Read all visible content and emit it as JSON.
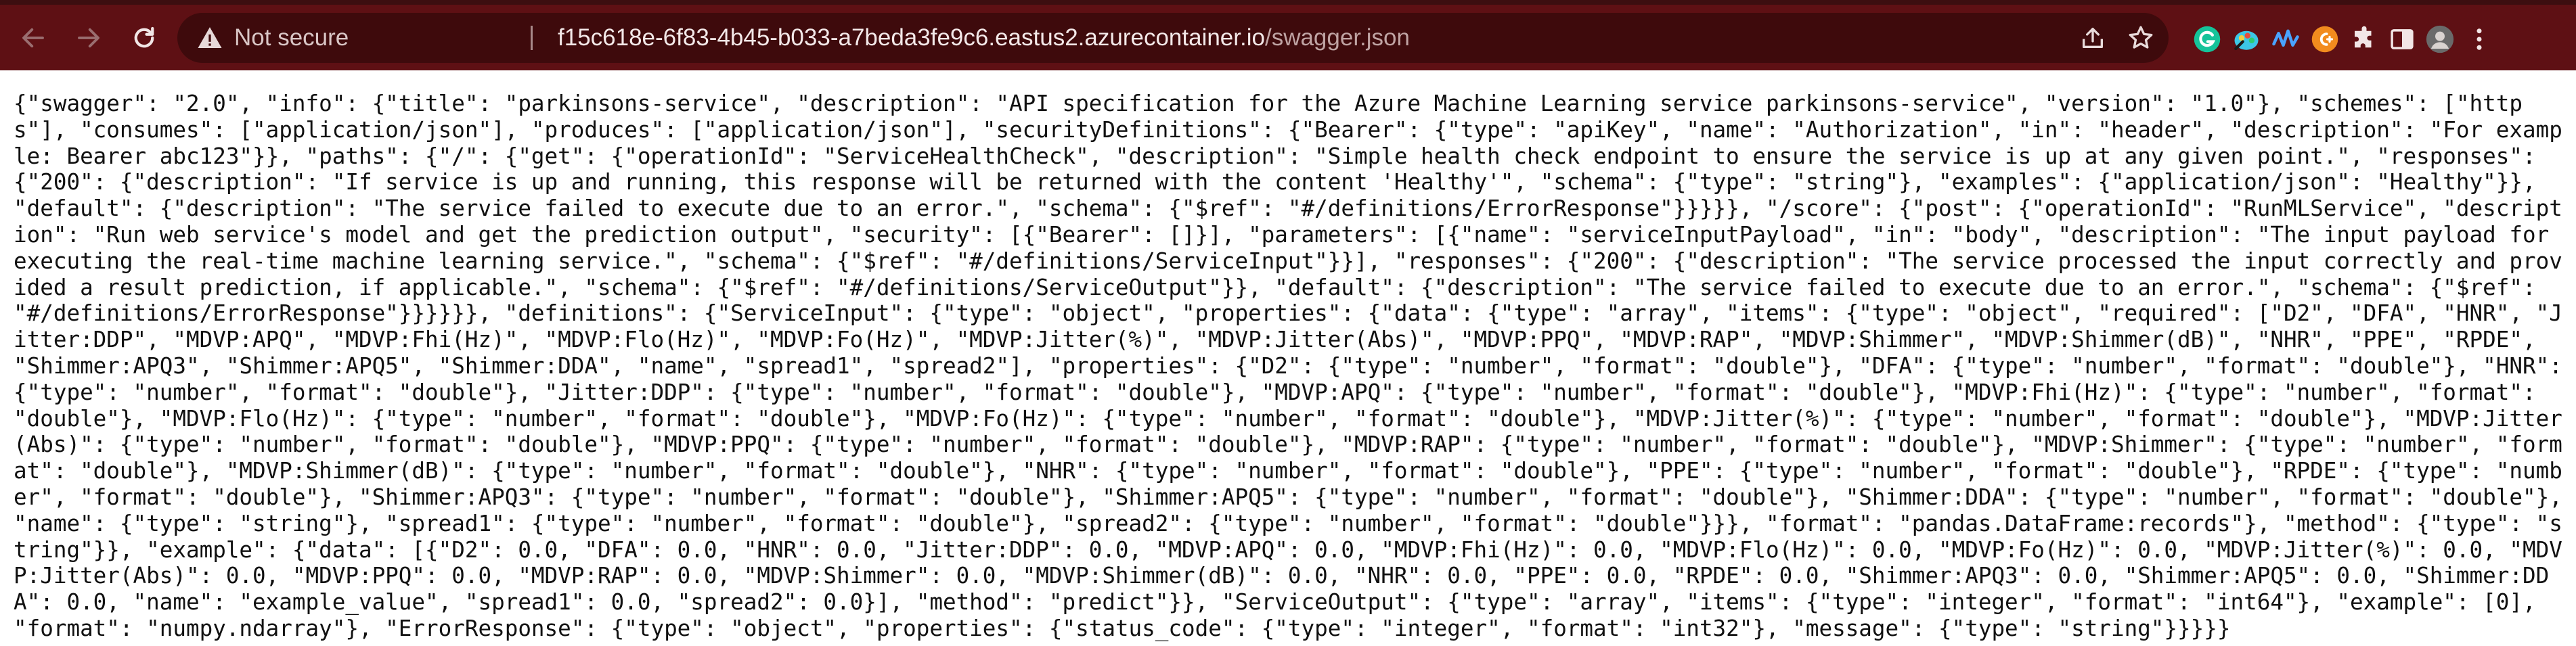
{
  "browser": {
    "security_status": "Not secure",
    "url_host": "f15c618e-6f83-4b45-b033-a7beda3fe9c6.eastus2.azurecontainer.io",
    "url_path": "/swagger.json",
    "toolbar_color": "#5e1014",
    "extensions": [
      "grammarly-icon",
      "color-picker-extension-icon",
      "waveform-extension-icon",
      "coupon-extension-icon",
      "puzzle-extensions-icon",
      "side-panel-icon",
      "profile-avatar"
    ]
  },
  "document": {
    "body_text": "{\"swagger\": \"2.0\", \"info\": {\"title\": \"parkinsons-service\", \"description\": \"API specification for the Azure Machine Learning service parkinsons-service\", \"version\": \"1.0\"}, \"schemes\": [\"https\"], \"consumes\": [\"application/json\"], \"produces\": [\"application/json\"], \"securityDefinitions\": {\"Bearer\": {\"type\": \"apiKey\", \"name\": \"Authorization\", \"in\": \"header\", \"description\": \"For example: Bearer abc123\"}}, \"paths\": {\"/\": {\"get\": {\"operationId\": \"ServiceHealthCheck\", \"description\": \"Simple health check endpoint to ensure the service is up at any given point.\", \"responses\": {\"200\": {\"description\": \"If service is up and running, this response will be returned with the content 'Healthy'\", \"schema\": {\"type\": \"string\"}, \"examples\": {\"application/json\": \"Healthy\"}}, \"default\": {\"description\": \"The service failed to execute due to an error.\", \"schema\": {\"$ref\": \"#/definitions/ErrorResponse\"}}}}}, \"/score\": {\"post\": {\"operationId\": \"RunMLService\", \"description\": \"Run web service's model and get the prediction output\", \"security\": [{\"Bearer\": []}], \"parameters\": [{\"name\": \"serviceInputPayload\", \"in\": \"body\", \"description\": \"The input payload for executing the real-time machine learning service.\", \"schema\": {\"$ref\": \"#/definitions/ServiceInput\"}}], \"responses\": {\"200\": {\"description\": \"The service processed the input correctly and provided a result prediction, if applicable.\", \"schema\": {\"$ref\": \"#/definitions/ServiceOutput\"}}, \"default\": {\"description\": \"The service failed to execute due to an error.\", \"schema\": {\"$ref\": \"#/definitions/ErrorResponse\"}}}}}}, \"definitions\": {\"ServiceInput\": {\"type\": \"object\", \"properties\": {\"data\": {\"type\": \"array\", \"items\": {\"type\": \"object\", \"required\": [\"D2\", \"DFA\", \"HNR\", \"Jitter:DDP\", \"MDVP:APQ\", \"MDVP:Fhi(Hz)\", \"MDVP:Flo(Hz)\", \"MDVP:Fo(Hz)\", \"MDVP:Jitter(%)\", \"MDVP:Jitter(Abs)\", \"MDVP:PPQ\", \"MDVP:RAP\", \"MDVP:Shimmer\", \"MDVP:Shimmer(dB)\", \"NHR\", \"PPE\", \"RPDE\", \"Shimmer:APQ3\", \"Shimmer:APQ5\", \"Shimmer:DDA\", \"name\", \"spread1\", \"spread2\"], \"properties\": {\"D2\": {\"type\": \"number\", \"format\": \"double\"}, \"DFA\": {\"type\": \"number\", \"format\": \"double\"}, \"HNR\": {\"type\": \"number\", \"format\": \"double\"}, \"Jitter:DDP\": {\"type\": \"number\", \"format\": \"double\"}, \"MDVP:APQ\": {\"type\": \"number\", \"format\": \"double\"}, \"MDVP:Fhi(Hz)\": {\"type\": \"number\", \"format\": \"double\"}, \"MDVP:Flo(Hz)\": {\"type\": \"number\", \"format\": \"double\"}, \"MDVP:Fo(Hz)\": {\"type\": \"number\", \"format\": \"double\"}, \"MDVP:Jitter(%)\": {\"type\": \"number\", \"format\": \"double\"}, \"MDVP:Jitter(Abs)\": {\"type\": \"number\", \"format\": \"double\"}, \"MDVP:PPQ\": {\"type\": \"number\", \"format\": \"double\"}, \"MDVP:RAP\": {\"type\": \"number\", \"format\": \"double\"}, \"MDVP:Shimmer\": {\"type\": \"number\", \"format\": \"double\"}, \"MDVP:Shimmer(dB)\": {\"type\": \"number\", \"format\": \"double\"}, \"NHR\": {\"type\": \"number\", \"format\": \"double\"}, \"PPE\": {\"type\": \"number\", \"format\": \"double\"}, \"RPDE\": {\"type\": \"number\", \"format\": \"double\"}, \"Shimmer:APQ3\": {\"type\": \"number\", \"format\": \"double\"}, \"Shimmer:APQ5\": {\"type\": \"number\", \"format\": \"double\"}, \"Shimmer:DDA\": {\"type\": \"number\", \"format\": \"double\"}, \"name\": {\"type\": \"string\"}, \"spread1\": {\"type\": \"number\", \"format\": \"double\"}, \"spread2\": {\"type\": \"number\", \"format\": \"double\"}}}, \"format\": \"pandas.DataFrame:records\"}, \"method\": {\"type\": \"string\"}}, \"example\": {\"data\": [{\"D2\": 0.0, \"DFA\": 0.0, \"HNR\": 0.0, \"Jitter:DDP\": 0.0, \"MDVP:APQ\": 0.0, \"MDVP:Fhi(Hz)\": 0.0, \"MDVP:Flo(Hz)\": 0.0, \"MDVP:Fo(Hz)\": 0.0, \"MDVP:Jitter(%)\": 0.0, \"MDVP:Jitter(Abs)\": 0.0, \"MDVP:PPQ\": 0.0, \"MDVP:RAP\": 0.0, \"MDVP:Shimmer\": 0.0, \"MDVP:Shimmer(dB)\": 0.0, \"NHR\": 0.0, \"PPE\": 0.0, \"RPDE\": 0.0, \"Shimmer:APQ3\": 0.0, \"Shimmer:APQ5\": 0.0, \"Shimmer:DDA\": 0.0, \"name\": \"example_value\", \"spread1\": 0.0, \"spread2\": 0.0}], \"method\": \"predict\"}}, \"ServiceOutput\": {\"type\": \"array\", \"items\": {\"type\": \"integer\", \"format\": \"int64\"}, \"example\": [0], \"format\": \"numpy.ndarray\"}, \"ErrorResponse\": {\"type\": \"object\", \"properties\": {\"status_code\": {\"type\": \"integer\", \"format\": \"int32\"}, \"message\": {\"type\": \"string\"}}}}}"
  }
}
